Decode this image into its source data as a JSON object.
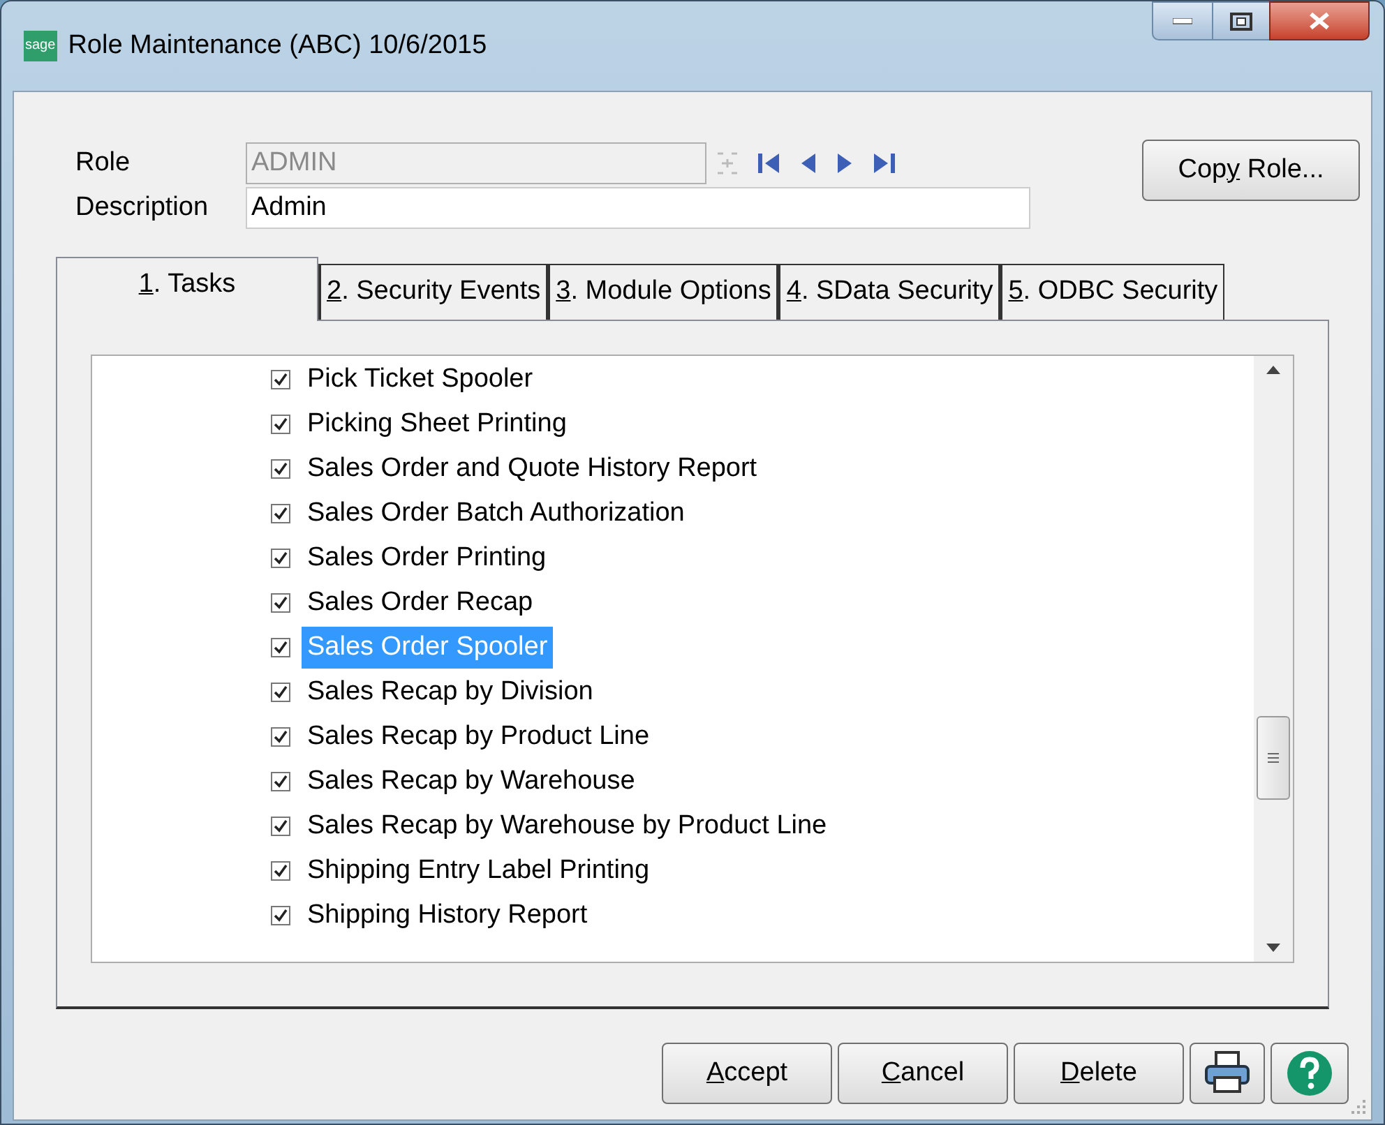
{
  "window": {
    "title": "Role Maintenance (ABC) 10/6/2015",
    "logo": "sage"
  },
  "role": {
    "label": "Role",
    "value": "ADMIN",
    "disabled": true
  },
  "description": {
    "label": "Description",
    "value": "Admin"
  },
  "copy_button": {
    "before": "Cop",
    "key": "y",
    "after": " Role..."
  },
  "tabs": [
    {
      "key": "1",
      "after": ". Tasks",
      "selected": true
    },
    {
      "key": "2",
      "after": ". Security Events",
      "selected": false
    },
    {
      "key": "3",
      "after": ". Module Options",
      "selected": false
    },
    {
      "key": "4",
      "after": ". SData Security",
      "selected": false
    },
    {
      "key": "5",
      "after": ". ODBC Security",
      "selected": false
    }
  ],
  "tasks": [
    {
      "label": "Pick Ticket Spooler",
      "checked": true,
      "selected": false
    },
    {
      "label": "Picking Sheet Printing",
      "checked": true,
      "selected": false
    },
    {
      "label": "Sales Order and Quote History Report",
      "checked": true,
      "selected": false
    },
    {
      "label": "Sales Order Batch Authorization",
      "checked": true,
      "selected": false
    },
    {
      "label": "Sales Order Printing",
      "checked": true,
      "selected": false
    },
    {
      "label": "Sales Order Recap",
      "checked": true,
      "selected": false
    },
    {
      "label": "Sales Order Spooler",
      "checked": true,
      "selected": true
    },
    {
      "label": "Sales Recap by Division",
      "checked": true,
      "selected": false
    },
    {
      "label": "Sales Recap by Product Line",
      "checked": true,
      "selected": false
    },
    {
      "label": "Sales Recap by Warehouse",
      "checked": true,
      "selected": false
    },
    {
      "label": "Sales Recap by Warehouse by Product Line",
      "checked": true,
      "selected": false
    },
    {
      "label": "Shipping Entry Label Printing",
      "checked": true,
      "selected": false
    },
    {
      "label": "Shipping History Report",
      "checked": true,
      "selected": false
    }
  ],
  "buttons": [
    {
      "key": "A",
      "after": "ccept"
    },
    {
      "key": "C",
      "after": "ancel"
    },
    {
      "key": "D",
      "after": "elete"
    }
  ]
}
